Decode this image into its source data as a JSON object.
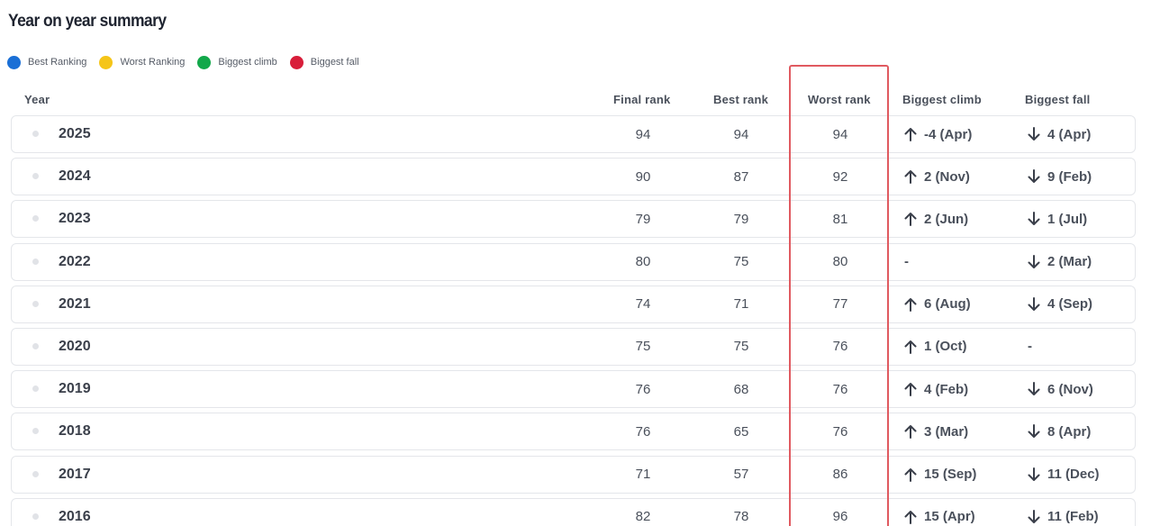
{
  "title": "Year on year summary",
  "legend": [
    {
      "label": "Best Ranking",
      "color": "#1a6fd6"
    },
    {
      "label": "Worst Ranking",
      "color": "#f5c518"
    },
    {
      "label": "Biggest climb",
      "color": "#12a84a"
    },
    {
      "label": "Biggest fall",
      "color": "#d81e3a"
    }
  ],
  "columns": {
    "year": "Year",
    "final": "Final rank",
    "best": "Best rank",
    "worst": "Worst rank",
    "climb": "Biggest climb",
    "fall": "Biggest fall"
  },
  "icons": {
    "climb": "arrow-up-icon",
    "fall": "arrow-down-icon"
  },
  "rows": [
    {
      "year": "2025",
      "final": "94",
      "best": "94",
      "worst": "94",
      "climb": "-4 (Apr)",
      "fall": "4 (Apr)"
    },
    {
      "year": "2024",
      "final": "90",
      "best": "87",
      "worst": "92",
      "climb": "2 (Nov)",
      "fall": "9 (Feb)"
    },
    {
      "year": "2023",
      "final": "79",
      "best": "79",
      "worst": "81",
      "climb": "2 (Jun)",
      "fall": "1 (Jul)"
    },
    {
      "year": "2022",
      "final": "80",
      "best": "75",
      "worst": "80",
      "climb": "-",
      "fall": "2 (Mar)"
    },
    {
      "year": "2021",
      "final": "74",
      "best": "71",
      "worst": "77",
      "climb": "6 (Aug)",
      "fall": "4 (Sep)"
    },
    {
      "year": "2020",
      "final": "75",
      "best": "75",
      "worst": "76",
      "climb": "1 (Oct)",
      "fall": "-"
    },
    {
      "year": "2019",
      "final": "76",
      "best": "68",
      "worst": "76",
      "climb": "4 (Feb)",
      "fall": "6 (Nov)"
    },
    {
      "year": "2018",
      "final": "76",
      "best": "65",
      "worst": "76",
      "climb": "3 (Mar)",
      "fall": "8 (Apr)"
    },
    {
      "year": "2017",
      "final": "71",
      "best": "57",
      "worst": "86",
      "climb": "15 (Sep)",
      "fall": "11 (Dec)"
    },
    {
      "year": "2016",
      "final": "82",
      "best": "78",
      "worst": "96",
      "climb": "15 (Apr)",
      "fall": "11 (Feb)"
    }
  ]
}
